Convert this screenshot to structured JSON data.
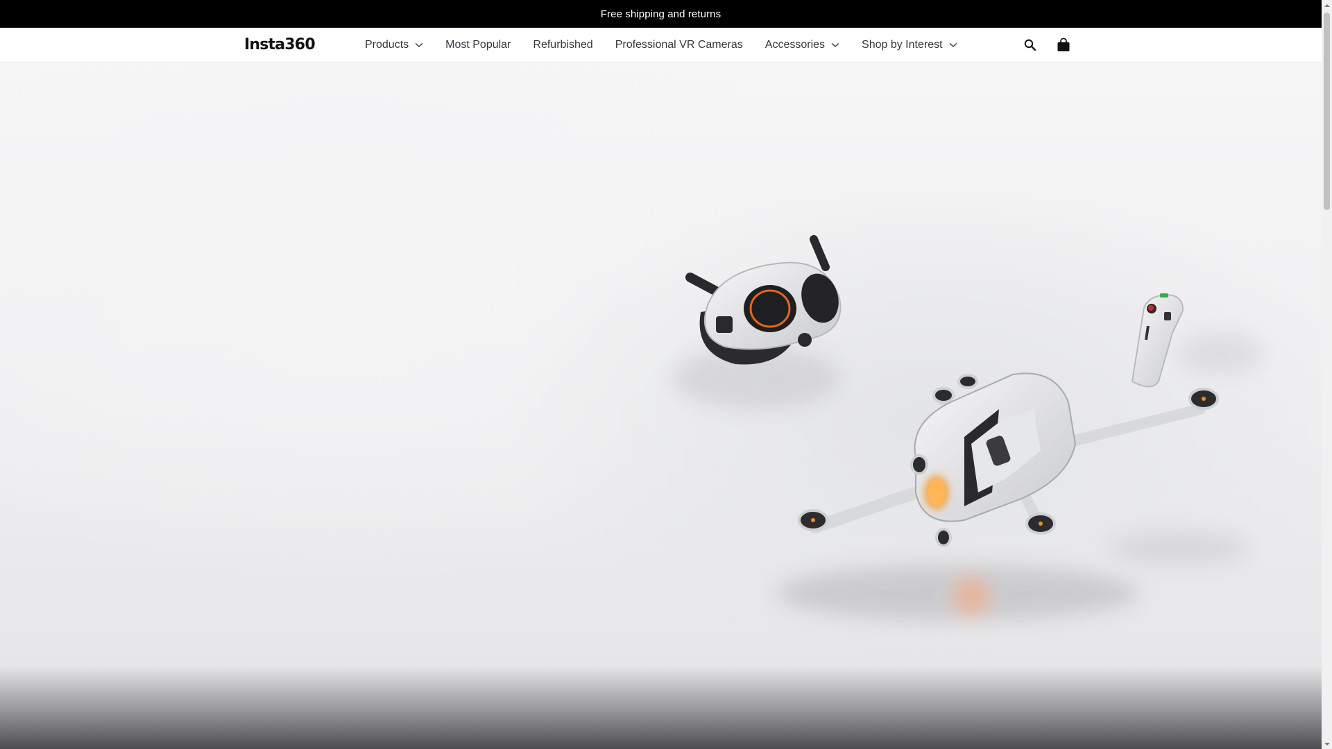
{
  "announcement": {
    "text": "Free shipping and returns"
  },
  "header": {
    "logo_text": "Insta360",
    "nav": [
      {
        "label": "Products",
        "has_dropdown": true
      },
      {
        "label": "Most Popular",
        "has_dropdown": false
      },
      {
        "label": "Refurbished",
        "has_dropdown": false
      },
      {
        "label": "Professional VR Cameras",
        "has_dropdown": false
      },
      {
        "label": "Accessories",
        "has_dropdown": true
      },
      {
        "label": "Shop by Interest",
        "has_dropdown": true
      }
    ],
    "icons": {
      "search": "search-icon",
      "cart": "shopping-bag-icon"
    }
  },
  "hero": {
    "image": "drone-with-goggles-and-motion-controller"
  },
  "colors": {
    "announcement_bg": "#000000",
    "announcement_text": "#ffffff",
    "nav_text": "#333740",
    "accent_orange": "#f08a24"
  }
}
